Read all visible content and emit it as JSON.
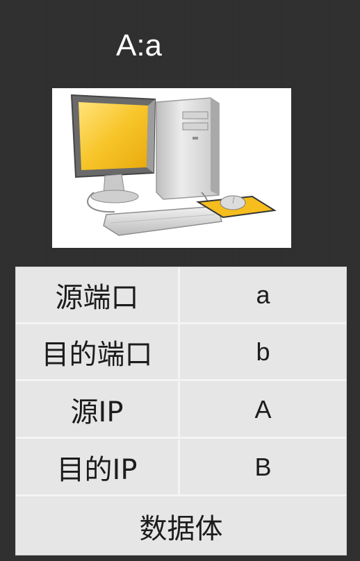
{
  "title": "A:a",
  "image": {
    "icon": "desktop-computer-icon",
    "colors": {
      "screen": "#f7c52a",
      "mousepad": "#f5bd1e",
      "case": "#d9d9d9"
    }
  },
  "packet": {
    "rows": [
      {
        "label": "源端口",
        "value": "a"
      },
      {
        "label": "目的端口",
        "value": "b"
      },
      {
        "label": "源IP",
        "value": "A"
      },
      {
        "label": "目的IP",
        "value": "B"
      }
    ],
    "body_label": "数据体"
  }
}
